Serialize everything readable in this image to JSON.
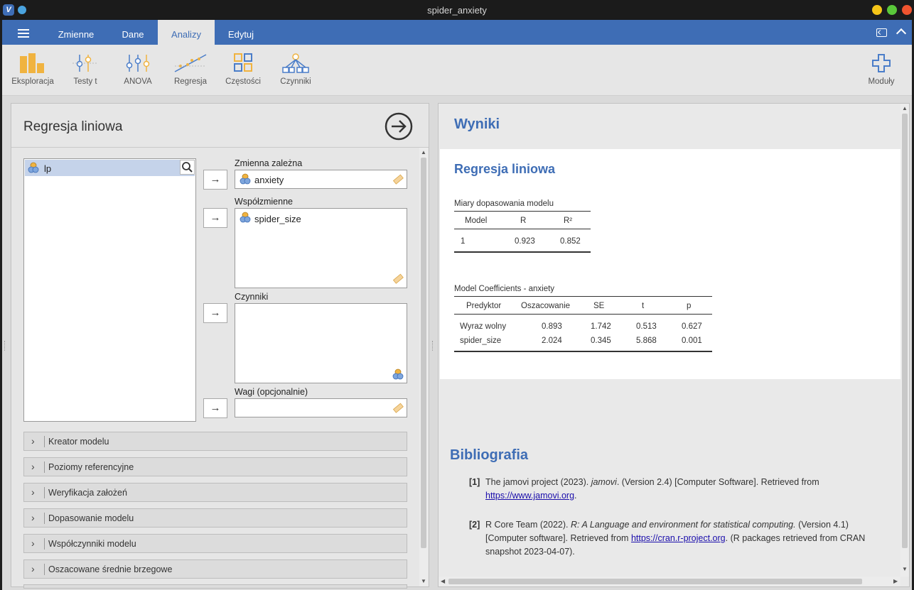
{
  "window": {
    "title": "spider_anxiety",
    "app_icon": "V"
  },
  "menu": {
    "tabs": [
      "Zmienne",
      "Dane",
      "Analizy",
      "Edytuj"
    ],
    "active_tab": "Analizy"
  },
  "ribbon": {
    "items": [
      "Eksploracja",
      "Testy t",
      "ANOVA",
      "Regresja",
      "Częstości",
      "Czynniki"
    ],
    "modules": "Moduły"
  },
  "analysis": {
    "title": "Regresja liniowa",
    "variable_list": [
      "lp"
    ],
    "dependent_label": "Zmienna zależna",
    "dependent_value": "anxiety",
    "covariates_label": "Współzmienne",
    "covariates": [
      "spider_size"
    ],
    "factors_label": "Czynniki",
    "weights_label": "Wagi (opcjonalnie)",
    "move_arrow": "→",
    "sections": [
      "Kreator modelu",
      "Poziomy referencyjne",
      "Weryfikacja założeń",
      "Dopasowanie modelu",
      "Współczynniki modelu",
      "Oszacowane średnie brzegowe"
    ]
  },
  "results": {
    "heading": "Wyniki",
    "analysis_title": "Regresja liniowa",
    "fit_table": {
      "title": "Miary dopasowania modelu",
      "headers": [
        "Model",
        "R",
        "R²"
      ],
      "rows": [
        [
          "1",
          "0.923",
          "0.852"
        ]
      ]
    },
    "coef_table": {
      "title": "Model Coefficients - anxiety",
      "headers": [
        "Predyktor",
        "Oszacowanie",
        "SE",
        "t",
        "p"
      ],
      "rows": [
        [
          "Wyraz wolny",
          "0.893",
          "1.742",
          "0.513",
          "0.627"
        ],
        [
          "spider_size",
          "2.024",
          "0.345",
          "5.868",
          "0.001"
        ]
      ]
    },
    "bibliography_heading": "Bibliografia",
    "references": [
      {
        "num": "[1]",
        "pre": "The jamovi project (2023). ",
        "italic": "jamovi",
        "post": ". (Version 2.4) [Computer Software]. Retrieved from ",
        "link": "https://www.jamovi.org",
        "end": "."
      },
      {
        "num": "[2]",
        "pre": "R Core Team (2022). ",
        "italic": "R: A Language and environment for statistical computing.",
        "post": " (Version 4.1) [Computer software]. Retrieved from ",
        "link": "https://cran.r-project.org",
        "end": ". (R packages retrieved from CRAN snapshot 2023-04-07)."
      }
    ]
  },
  "colors": {
    "accent": "#3e6db5",
    "selection": "#c5d3ea"
  }
}
